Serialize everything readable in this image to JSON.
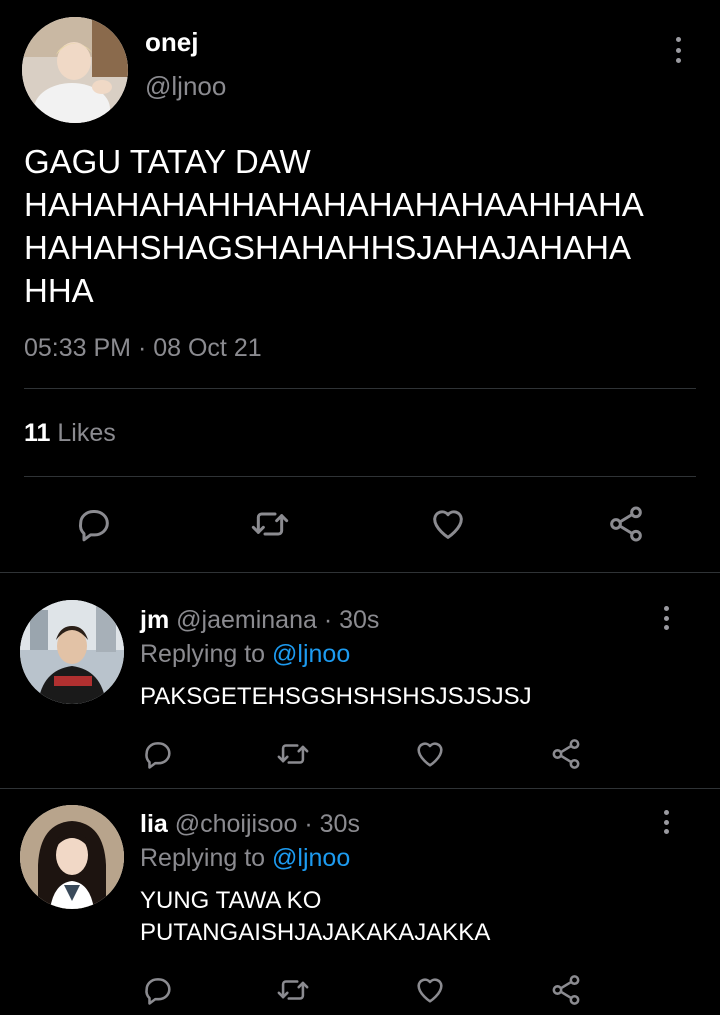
{
  "main_tweet": {
    "name": "onej",
    "handle": "@ljnoo",
    "text": "GAGU TATAY DAW\nHAHAHAHAHHAHAHAHAHAHAAHHAHA\nHAHAHSHAGSHAHAHHSJAHAJAHAHA\nHHA",
    "timestamp": "05:33 PM · 08 Oct 21",
    "likes_count": "11",
    "likes_label": "Likes",
    "actions": [
      "reply-icon",
      "retweet-icon",
      "like-icon",
      "share-icon"
    ]
  },
  "replies": [
    {
      "name": "jm",
      "handle": "@jaeminana",
      "time": "· 30s",
      "replying_prefix": "Replying to",
      "replying_to": "@ljnoo",
      "text": "PAKSGETEHSGSHSHSHSJSJSJSJ"
    },
    {
      "name": "lia",
      "handle": "@choijisoo",
      "time": "· 30s",
      "replying_prefix": "Replying to",
      "replying_to": "@ljnoo",
      "text": "YUNG TAWA KO\nPUTANGAISHJAJAKAKAJAKKA"
    }
  ],
  "colors": {
    "background": "#000000",
    "secondary_text": "#8b8b90",
    "mention": "#1d9bf0",
    "divider": "#2f3336"
  }
}
